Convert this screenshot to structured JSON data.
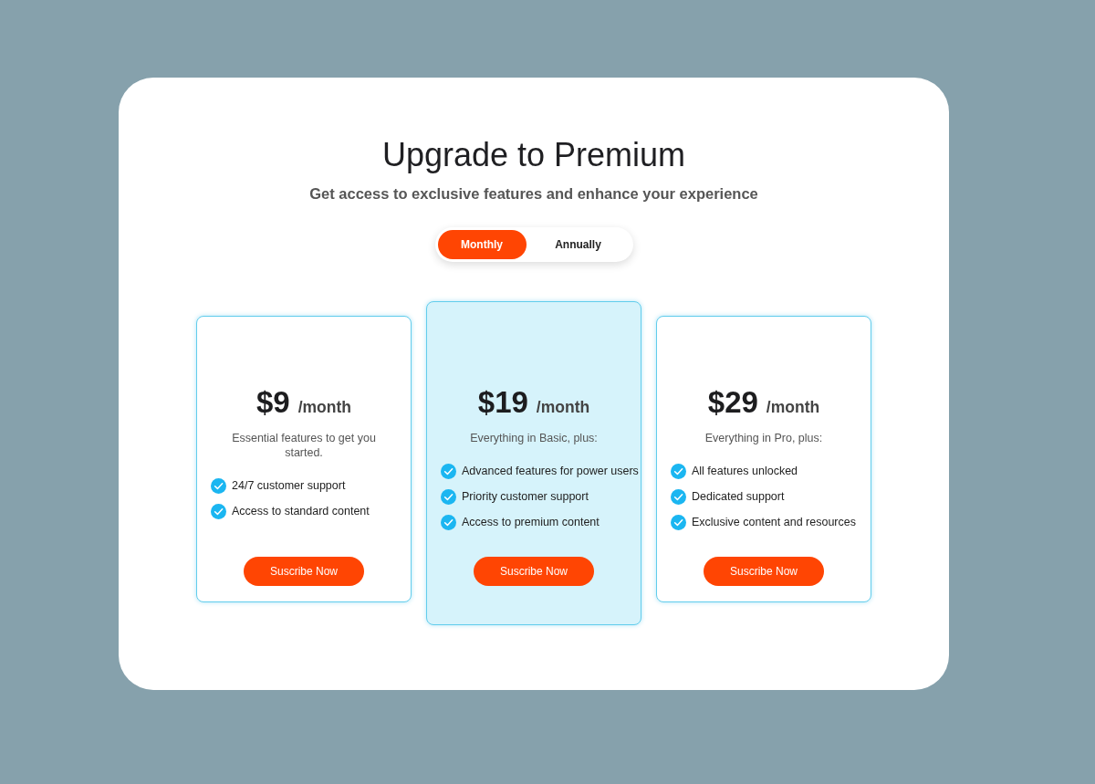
{
  "heading": {
    "title": "Upgrade to Premium",
    "subtitle": "Get access to exclusive features and enhance your experience"
  },
  "billing_toggle": [
    {
      "label": "Monthly",
      "selected": true
    },
    {
      "label": "Annually",
      "selected": false
    }
  ],
  "plans": [
    {
      "price": "$9",
      "period": "/month",
      "description": "Essential features to get you started.",
      "features": [
        "24/7 customer support",
        "Access to standard content"
      ],
      "button": "Suscribe Now",
      "highlighted": false
    },
    {
      "price": "$19",
      "period": "/month",
      "description": "Everything in Basic, plus:",
      "features": [
        "Advanced features for power users",
        "Priority customer support",
        "Access to premium content"
      ],
      "button": "Suscribe Now",
      "highlighted": true
    },
    {
      "price": "$29",
      "period": "/month",
      "description": "Everything in Pro, plus:",
      "features": [
        "All features unlocked",
        "Dedicated support",
        "Exclusive content and resources"
      ],
      "button": "Suscribe Now",
      "highlighted": false
    }
  ]
}
